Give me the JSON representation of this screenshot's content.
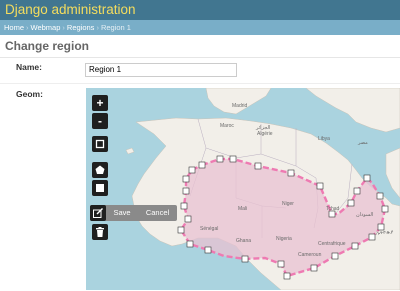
{
  "header": {
    "site_title": "Django administration"
  },
  "breadcrumbs": {
    "items": [
      {
        "label": "Home"
      },
      {
        "label": "Webmap"
      },
      {
        "label": "Regions"
      }
    ],
    "separator": "›",
    "current": "Region 1"
  },
  "page": {
    "title": "Change region"
  },
  "form": {
    "name": {
      "label": "Name:",
      "value": "Region 1"
    },
    "geom": {
      "label": "Geom:"
    }
  },
  "map": {
    "controls": {
      "zoom_in": "+",
      "zoom_out": "-",
      "save": "Save",
      "cancel": "Cancel"
    },
    "icons": {
      "draw_box": "square-icon",
      "draw_polygon": "pentagon-icon",
      "draw_square": "filled-square-icon",
      "modify": "edit-icon",
      "delete": "trash-icon"
    },
    "places": {
      "madrid": "Madrid",
      "algerie": "Algérie",
      "el_djazair": "الجزائر",
      "maroc": "Maroc",
      "libya": "Libya",
      "mali": "Mali",
      "niger": "Niger",
      "nigeria": "Nigeria",
      "chad": "Tchad",
      "egypt": "مصر",
      "sudan": "السودان",
      "cameroon": "Cameroun",
      "centrafrique": "Centrafrique",
      "ghana": "Ghana",
      "senegal": "Sénégal",
      "ethiopia": "ኢትዮጵያ"
    },
    "colors": {
      "water": "#aad3df",
      "land": "#f2efe9",
      "polygon_fill": "#e8c2d2",
      "polygon_stroke": "#ee7ab2",
      "vertex_fill": "#ffffff",
      "control_bg": "#1f1f1f"
    }
  }
}
